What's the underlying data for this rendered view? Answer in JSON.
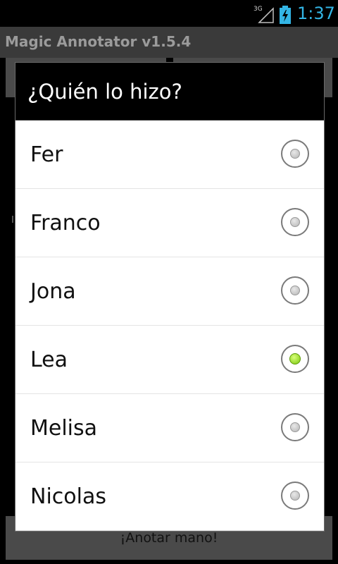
{
  "status_bar": {
    "network": "3G",
    "time": "1:37",
    "time_color": "#33b5e5"
  },
  "app": {
    "title": "Magic Annotator v1.5.4",
    "bottom_button_label": "¡Anotar mano!"
  },
  "dialog": {
    "title": "¿Quién lo hizo?",
    "options": [
      {
        "label": "Fer",
        "checked": false
      },
      {
        "label": "Franco",
        "checked": false
      },
      {
        "label": "Jona",
        "checked": false
      },
      {
        "label": "Lea",
        "checked": true
      },
      {
        "label": "Melisa",
        "checked": false
      },
      {
        "label": "Nicolas",
        "checked": false
      }
    ],
    "selected": "Lea",
    "checked_color": "#7ac70c"
  }
}
